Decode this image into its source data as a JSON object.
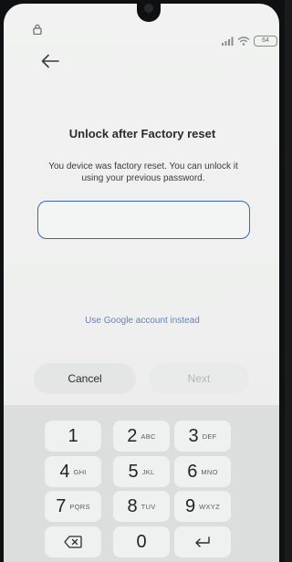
{
  "status_bar": {
    "battery": "64"
  },
  "screen": {
    "title": "Unlock after Factory reset",
    "description": "You device was factory reset. You can unlock it using your previous password.",
    "password": {
      "value": "",
      "placeholder": ""
    },
    "google_link": "Use Google account instead",
    "cancel_label": "Cancel",
    "next_label": "Next"
  },
  "keypad": {
    "keys": [
      {
        "num": "1",
        "letters": ""
      },
      {
        "num": "2",
        "letters": "ABC"
      },
      {
        "num": "3",
        "letters": "DEF"
      },
      {
        "num": "4",
        "letters": "GHI"
      },
      {
        "num": "5",
        "letters": "JKL"
      },
      {
        "num": "6",
        "letters": "MNO"
      },
      {
        "num": "7",
        "letters": "PQRS"
      },
      {
        "num": "8",
        "letters": "TUV"
      },
      {
        "num": "9",
        "letters": "WXYZ"
      },
      {
        "num": "0",
        "letters": ""
      }
    ],
    "icons": {
      "backspace": "backspace-icon",
      "enter": "enter-icon"
    }
  },
  "colors": {
    "accent": "#3c66b4",
    "link": "#6585b9",
    "background": "#eeefee",
    "keyboard": "#dcdddd"
  }
}
